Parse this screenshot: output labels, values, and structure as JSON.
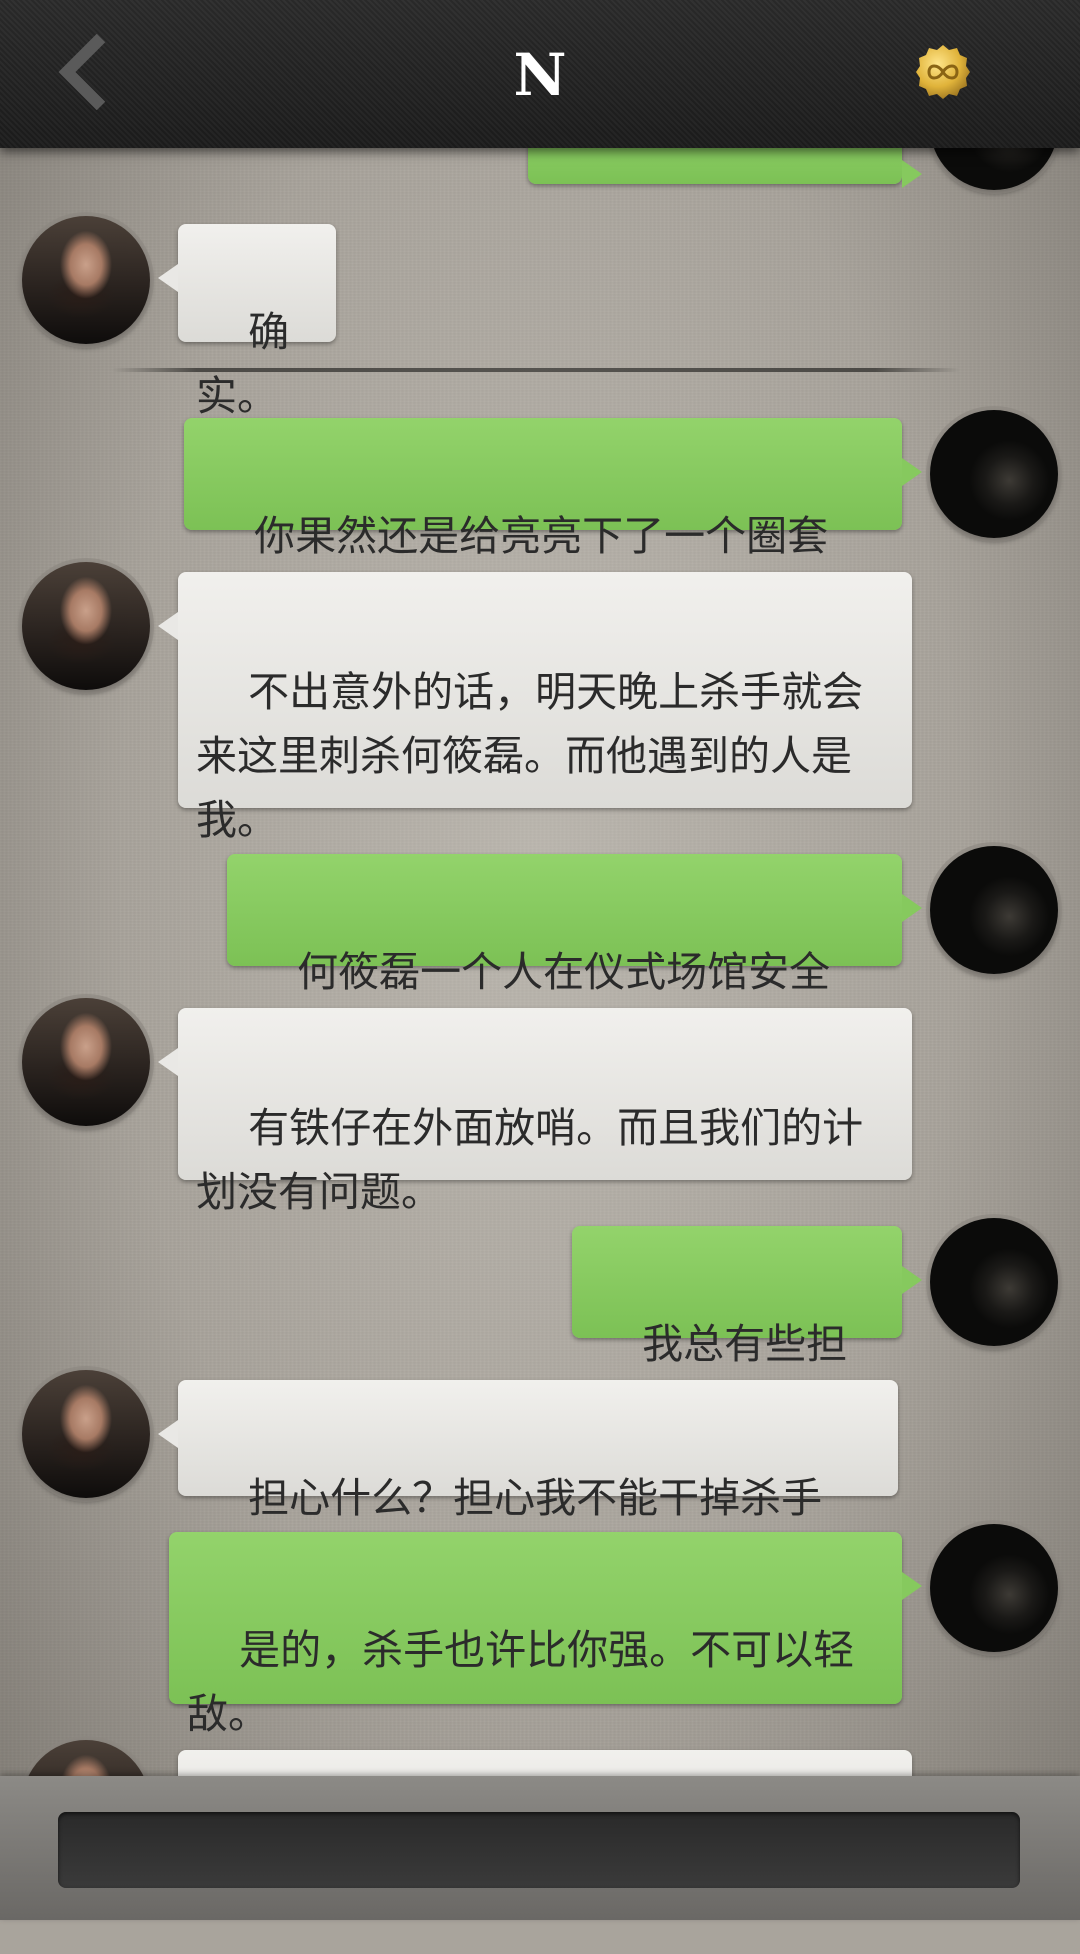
{
  "header": {
    "title": "N",
    "back_icon": "chevron-left-icon",
    "coin_icon": "infinity-coin-icon"
  },
  "messages": [
    {
      "side": "right",
      "text": "",
      "partial": true
    },
    {
      "side": "left",
      "text": "确实。"
    },
    {
      "side": "right",
      "text": "你果然还是给亮亮下了一个圈套啊。"
    },
    {
      "side": "left",
      "text": "不出意外的话，明天晚上杀手就会来这里刺杀何筱磊。而他遇到的人是我。"
    },
    {
      "side": "right",
      "text": "何筱磊一个人在仪式场馆安全吗？"
    },
    {
      "side": "left",
      "text": "有铁仔在外面放哨。而且我们的计划没有问题。"
    },
    {
      "side": "right",
      "text": "我总有些担心。"
    },
    {
      "side": "left",
      "text": "担心什么？担心我不能干掉杀手吗？"
    },
    {
      "side": "right",
      "text": "是的，杀手也许比你强。不可以轻敌。"
    },
    {
      "side": "left",
      "text": "",
      "partial": true
    }
  ],
  "input": {
    "placeholder": ""
  },
  "colors": {
    "outgoing_bubble": "#86c95e",
    "incoming_bubble": "#e9e8e5",
    "topbar": "#222222",
    "coin": "#e0b33a"
  }
}
